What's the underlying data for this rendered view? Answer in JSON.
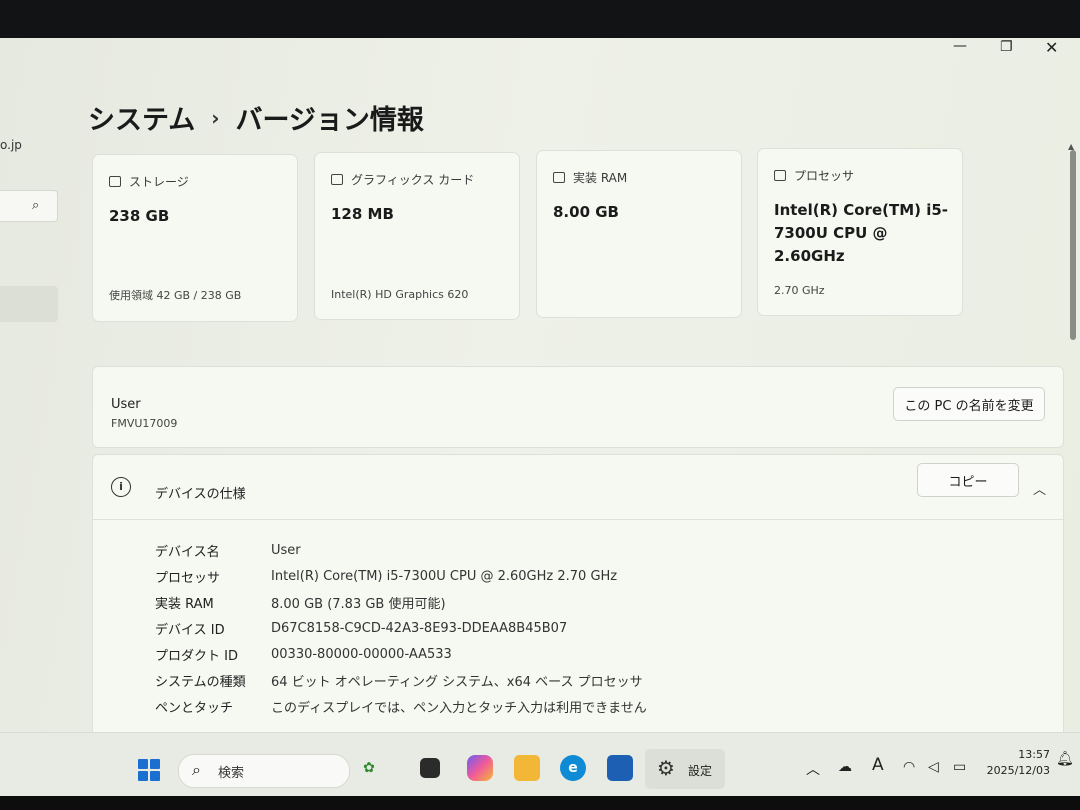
{
  "window": {
    "title_parent": "システム",
    "title_separator": "›",
    "title_current": "バージョン情報",
    "controls": {
      "minimize": "—",
      "maximize": "❐",
      "close": "✕"
    }
  },
  "nav": {
    "url_fragment": "o.jp",
    "search_icon": "search-icon"
  },
  "cards": [
    {
      "icon": "storage-icon",
      "label": "ストレージ",
      "value": "238 GB",
      "sub": "使用領域 42 GB / 238 GB"
    },
    {
      "icon": "graphics-card-icon",
      "label": "グラフィックス カード",
      "value": "128 MB",
      "sub": "Intel(R) HD Graphics 620"
    },
    {
      "icon": "ram-icon",
      "label": "実装 RAM",
      "value": "8.00 GB",
      "sub": ""
    },
    {
      "icon": "processor-icon",
      "label": "プロセッサ",
      "value": "Intel(R) Core(TM) i5-7300U CPU @ 2.60GHz",
      "sub": "2.70 GHz"
    }
  ],
  "device": {
    "name": "User",
    "host": "FMVU17009",
    "rename_button": "この PC の名前を変更"
  },
  "specs": {
    "title": "デバイスの仕様",
    "copy_button": "コピー",
    "rows": [
      {
        "label": "デバイス名",
        "value": "User"
      },
      {
        "label": "プロセッサ",
        "value": "Intel(R) Core(TM) i5-7300U CPU @ 2.60GHz   2.70 GHz"
      },
      {
        "label": "実装 RAM",
        "value": "8.00 GB (7.83 GB 使用可能)"
      },
      {
        "label": "デバイス ID",
        "value": "D67C8158-C9CD-42A3-8E93-DDEAA8B45B07"
      },
      {
        "label": "プロダクト ID",
        "value": "00330-80000-00000-AA533"
      },
      {
        "label": "システムの種類",
        "value": "64 ビット オペレーティング システム、x64 ベース プロセッサ"
      },
      {
        "label": "ペンとタッチ",
        "value": "このディスプレイでは、ペン入力とタッチ入力は利用できません"
      }
    ]
  },
  "taskbar": {
    "search_placeholder": "検索",
    "settings_label": "設定",
    "time": "13:57",
    "date": "2025/12/03",
    "ime": "A",
    "colors": {
      "start": "#1a6fd1",
      "edge": "#0f8bd6",
      "explorer": "#f2b736"
    }
  }
}
